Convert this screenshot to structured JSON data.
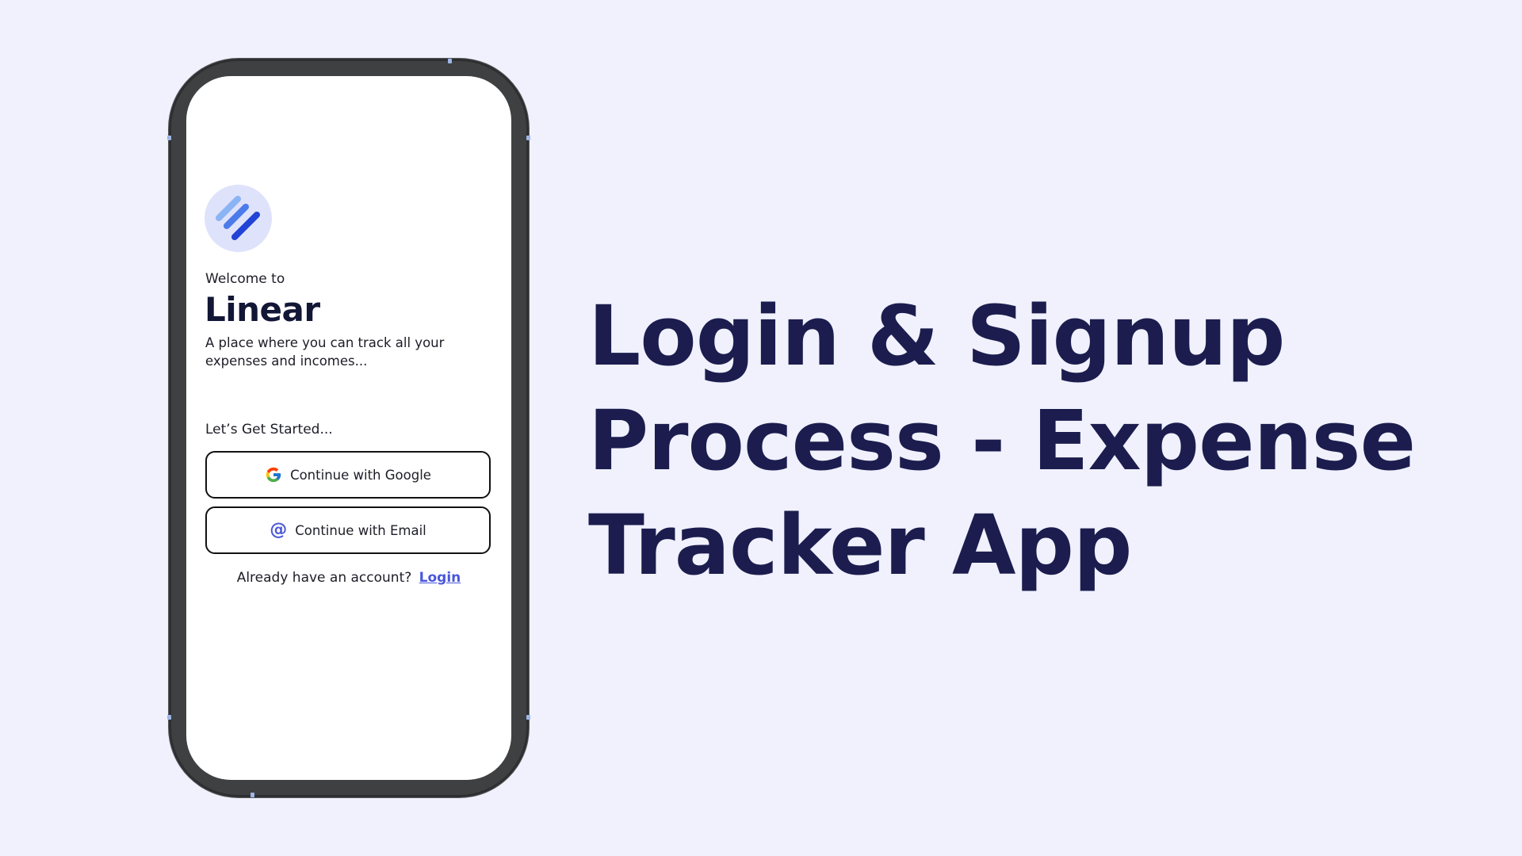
{
  "phone_screen": {
    "logo_icon": "stacked-stripes-logo-icon",
    "welcome": "Welcome to",
    "brand": "Linear",
    "tagline": "A place where you can track all your expenses and incomes...",
    "started": "Let’s Get Started...",
    "google_button": "Continue with Google",
    "email_button": "Continue with Email",
    "account_prompt": "Already have an account?",
    "login_link": "Login"
  },
  "headline": {
    "line1": "Login & Signup",
    "line2": "Process - Expense",
    "line3": "Tracker App"
  },
  "colors": {
    "background": "#f0f1fd",
    "headline": "#1c1d4e",
    "accent": "#4a57dc",
    "logo_circle": "#dfe2fb"
  }
}
